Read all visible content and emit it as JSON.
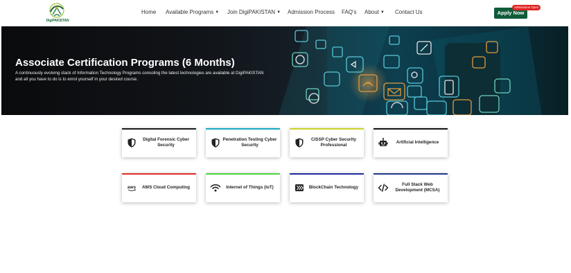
{
  "header": {
    "logo_text": "DigiPAKISTAN",
    "nav": [
      {
        "label": "Home",
        "dropdown": false
      },
      {
        "label": "Available Programs",
        "dropdown": true
      },
      {
        "label": "Join DigiPAKISTAN",
        "dropdown": true
      },
      {
        "label": "Admission Process",
        "dropdown": false
      },
      {
        "label": "FAQ's",
        "dropdown": false
      },
      {
        "label": "About",
        "dropdown": true
      },
      {
        "label": "Contact Us",
        "dropdown": false
      }
    ],
    "apply_label": "Apply Now",
    "badge": "Admissions Open"
  },
  "hero": {
    "title": "Associate Certification Programs (6 Months)",
    "description": "A continuously evolving stack of Information Technology Programs consoling the latest technologies are available at DigiPAKISTAN and all you have to do is to enrol yourself in your desired course."
  },
  "programs": [
    {
      "label": "Digital Forensic Cyber Security",
      "icon": "shield-icon",
      "color": "#1a1a1a"
    },
    {
      "label": "Penetration Testing Cyber Security",
      "icon": "shield-icon",
      "color": "#17a8c4"
    },
    {
      "label": "CISSP Cyber Security Professional",
      "icon": "shield-icon",
      "color": "#cdd22a"
    },
    {
      "label": "Artificial Intelligence",
      "icon": "robot-icon",
      "color": "#111111"
    },
    {
      "label": "AWS Cloud Computing",
      "icon": "aws-icon",
      "color": "#e02b2b"
    },
    {
      "label": "Internet of Things (IoT)",
      "icon": "wifi-icon",
      "color": "#4cd43c"
    },
    {
      "label": "BlockChain Technology",
      "icon": "blockchain-icon",
      "color": "#1f2aa0"
    },
    {
      "label": "Full Stack Web Development (MCSA)",
      "icon": "code-icon",
      "color": "#1a3a8a"
    }
  ]
}
